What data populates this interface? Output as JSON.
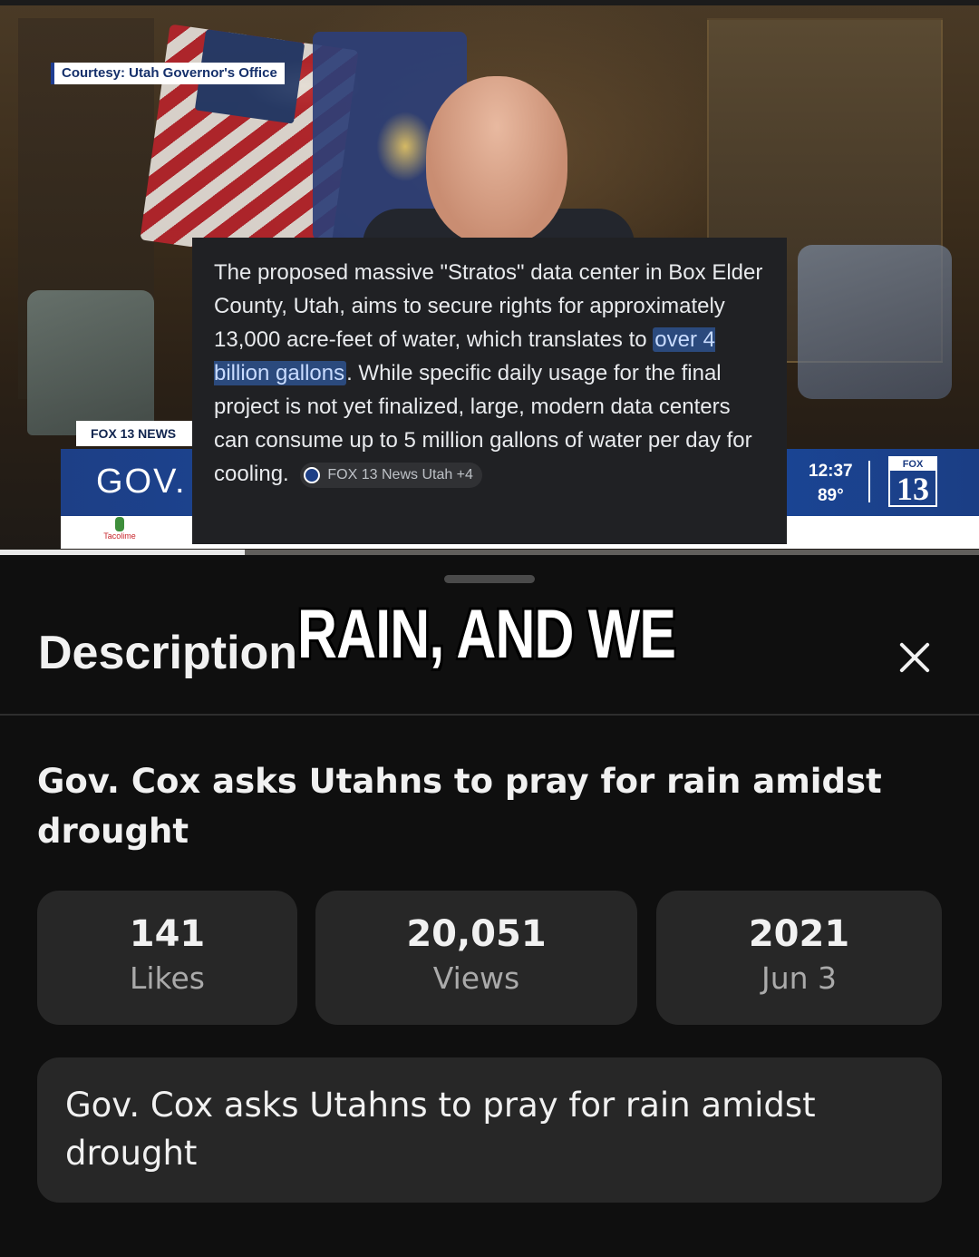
{
  "video": {
    "courtesy": "Courtesy: Utah Governor's Office",
    "lower_third": {
      "label": "FOX 13 NEWS",
      "headline": "GOV. C",
      "time": "12:37",
      "temperature": "89°",
      "channel_word": "FOX",
      "channel_number": "13",
      "sponsor": "Tacolime"
    },
    "progress_percent": 25
  },
  "ai_overlay": {
    "text_before": "The proposed massive \"Stratos\" data center in Box Elder County, Utah, aims to secure rights for approximately 13,000 acre-feet of water, which translates to ",
    "highlight": "over 4 billion gallons",
    "text_after": ". While specific daily usage for the final project is not yet finalized, large, modern data centers can consume up to 5 million gallons of water per day for cooling.",
    "source_chip": "FOX 13 News Utah +4"
  },
  "sheet": {
    "title": "Description",
    "caption_overlay": "RAIN, AND WE",
    "close_icon": "close-icon",
    "video_title": "Gov. Cox asks Utahns to pray for rain amidst drought",
    "stats": [
      {
        "value": "141",
        "label": "Likes"
      },
      {
        "value": "20,051",
        "label": "Views"
      },
      {
        "value": "2021",
        "label": "Jun 3"
      }
    ],
    "description": "Gov. Cox asks Utahns to pray for rain amidst drought"
  }
}
